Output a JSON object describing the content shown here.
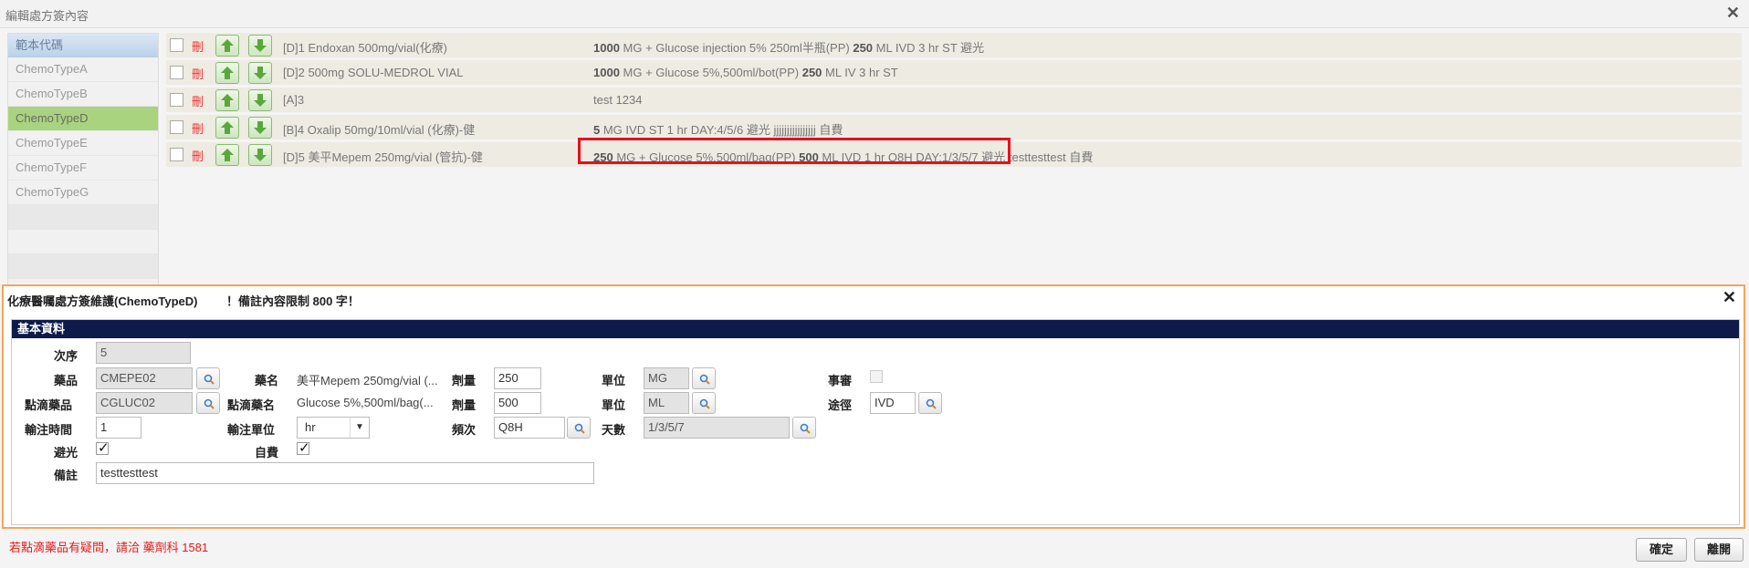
{
  "window": {
    "title": "編輯處方簽內容",
    "close_icon": "close-icon"
  },
  "templates": {
    "header": "範本代碼",
    "items": [
      "ChemoTypeA",
      "ChemoTypeB",
      "ChemoTypeD",
      "ChemoTypeE",
      "ChemoTypeF",
      "ChemoTypeG"
    ],
    "selected": "ChemoTypeD"
  },
  "rows": [
    {
      "delete_label": "刪",
      "drug": "[D]1 Endoxan 500mg/vial(化療)",
      "qty": "1000",
      "unit": " MG",
      "dose_rest": "  + Glucose injection 5% 250ml半瓶(PP) ",
      "qty2": "250",
      "rest2": " ML IVD 3 hr ST 避光"
    },
    {
      "delete_label": "刪",
      "drug": "[D]2 500mg SOLU-MEDROL VIAL",
      "qty": "1000",
      "unit": " MG",
      "dose_rest": "  + Glucose 5%,500ml/bot(PP) ",
      "qty2": "250",
      "rest2": " ML IV 3 hr ST"
    },
    {
      "delete_label": "刪",
      "drug": "[A]3",
      "qty": "",
      "unit": "",
      "dose_rest": "test 1234",
      "qty2": "",
      "rest2": ""
    },
    {
      "delete_label": "刪",
      "drug": "[B]4 Oxalip 50mg/10ml/vial (化療)-健",
      "qty": "5",
      "unit": " MG",
      "dose_rest": " IVD ST 1 hr DAY:4/5/6 避光 jjjjjjjjjjjjjjjj 自費",
      "qty2": "",
      "rest2": ""
    },
    {
      "delete_label": "刪",
      "drug": "[D]5 美平Mepem 250mg/vial (管抗)-健",
      "qty": "250",
      "unit": " MG",
      "dose_rest": "  + Glucose 5%,500ml/bag(PP) ",
      "qty2": "500",
      "rest2": " ML IVD 1 hr Q8H DAY:1/3/5/7 避光 testtesttest 自費"
    }
  ],
  "editor": {
    "title": "化療醫囑處方簽維護(ChemoTypeD)",
    "note": "！備註內容限制 800 字！",
    "section": "基本資料",
    "fields": {
      "seq_label": "次序",
      "seq": "5",
      "drug_label": "藥品",
      "drug": "CMEPE02",
      "drug_name_label": "藥名",
      "drug_name": "美平Mepem 250mg/vial (...",
      "dose_label": "劑量",
      "dose": "250",
      "unit_label": "單位",
      "unit": "MG",
      "review_label": "事審",
      "drip_label": "點滴藥品",
      "drip": "CGLUC02",
      "drip_name_label": "點滴藥名",
      "drip_name": "Glucose 5%,500ml/bag(...",
      "drip_dose_label": "劑量",
      "drip_dose": "500",
      "drip_unit_label": "單位",
      "drip_unit": "ML",
      "route_label": "途徑",
      "route": "IVD",
      "infusion_time_label": "輸注時間",
      "infusion_time": "1",
      "infusion_unit_label": "輸注單位",
      "infusion_unit": "hr",
      "freq_label": "頻次",
      "freq": "Q8H",
      "days_label": "天數",
      "days": "1/3/5/7",
      "light_label": "避光",
      "selfpay_label": "自費",
      "remark_label": "備註",
      "remark": "testtesttest"
    }
  },
  "footer": {
    "message": "若點滴藥品有疑問，請洽 藥劑科 1581",
    "ok": "確定",
    "leave": "離開"
  }
}
